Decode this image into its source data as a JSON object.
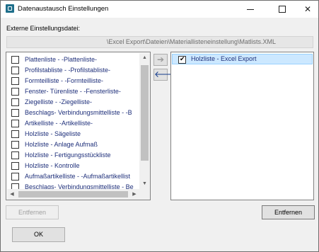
{
  "window": {
    "title": "Datenaustausch Einstellungen",
    "controls": {
      "minimize": "—",
      "maximize": "☐",
      "close": "✕"
    }
  },
  "file": {
    "label": "Externe Einstellungsdatei:",
    "path": "\\Excel Export\\Dateien\\Materiallisteneinstellung\\Matlists.XML"
  },
  "available_lists": [
    {
      "label": "Plattenliste - -Plattenliste-",
      "checked": false
    },
    {
      "label": "Profilstabliste - -Profilstabliste-",
      "checked": false
    },
    {
      "label": "Formteilliste - -Formteilliste-",
      "checked": false
    },
    {
      "label": "Fenster- Türenliste - -Fensterliste-",
      "checked": false
    },
    {
      "label": "Ziegelliste - -Ziegelliste-",
      "checked": false
    },
    {
      "label": "Beschlags- Verbindungsmittelliste - -B",
      "checked": false
    },
    {
      "label": "Artikelliste - -Artikelliste-",
      "checked": false
    },
    {
      "label": "Holzliste - Sägeliste",
      "checked": false
    },
    {
      "label": "Holzliste - Anlage Aufmaß",
      "checked": false
    },
    {
      "label": "Holzliste - Fertigungsstückliste",
      "checked": false
    },
    {
      "label": "Holzliste - Kontrolle",
      "checked": false
    },
    {
      "label": "Aufmaßartikelliste - -Aufmaßartikellist",
      "checked": false
    },
    {
      "label": "Beschlags- Verbindungsmittelliste - Be",
      "checked": false
    }
  ],
  "selected_lists": [
    {
      "label": "Holzliste - Excel Export",
      "checked": true
    }
  ],
  "transfer": {
    "add_icon": "arrow-right-icon",
    "remove_icon": "arrow-left-icon"
  },
  "buttons": {
    "remove_left": "Entfernen",
    "remove_right": "Entfernen",
    "ok": "OK"
  }
}
